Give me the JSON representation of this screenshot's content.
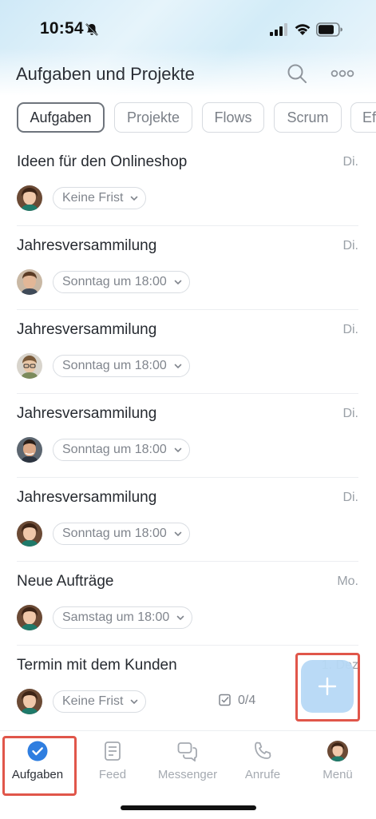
{
  "status_bar": {
    "time": "10:54"
  },
  "header": {
    "title": "Aufgaben und Projekte"
  },
  "tabs": [
    {
      "label": "Aufgaben",
      "active": true
    },
    {
      "label": "Projekte"
    },
    {
      "label": "Flows"
    },
    {
      "label": "Scrum"
    },
    {
      "label": "Ef"
    }
  ],
  "tasks": [
    {
      "title": "Ideen für den Onlineshop",
      "date": "Di.",
      "deadline": "Keine Frist",
      "avatar": "woman"
    },
    {
      "title": "Jahresversammilung",
      "date": "Di.",
      "deadline": "Sonntag um 18:00",
      "avatar": "man-1"
    },
    {
      "title": "Jahresversammilung",
      "date": "Di.",
      "deadline": "Sonntag um 18:00",
      "avatar": "man-2"
    },
    {
      "title": "Jahresversammilung",
      "date": "Di.",
      "deadline": "Sonntag um 18:00",
      "avatar": "man-3"
    },
    {
      "title": "Jahresversammilung",
      "date": "Di.",
      "deadline": "Sonntag um 18:00",
      "avatar": "woman"
    },
    {
      "title": "Neue Aufträge",
      "date": "Mo.",
      "deadline": "Samstag um 18:00",
      "avatar": "woman"
    },
    {
      "title": "Termin mit dem Kunden",
      "date": "1. Dez",
      "deadline": "Keine Frist",
      "avatar": "woman",
      "checklist": "0/4"
    }
  ],
  "bottom_nav": [
    {
      "label": "Aufgaben",
      "icon": "check-circle-icon",
      "active": true
    },
    {
      "label": "Feed",
      "icon": "feed-icon"
    },
    {
      "label": "Messenger",
      "icon": "chat-icon"
    },
    {
      "label": "Anrufe",
      "icon": "phone-icon"
    },
    {
      "label": "Menü",
      "icon": "avatar-icon"
    }
  ],
  "colors": {
    "accent": "#2f7ee0",
    "fab": "#b7d9f6",
    "highlight": "#e0564a"
  }
}
